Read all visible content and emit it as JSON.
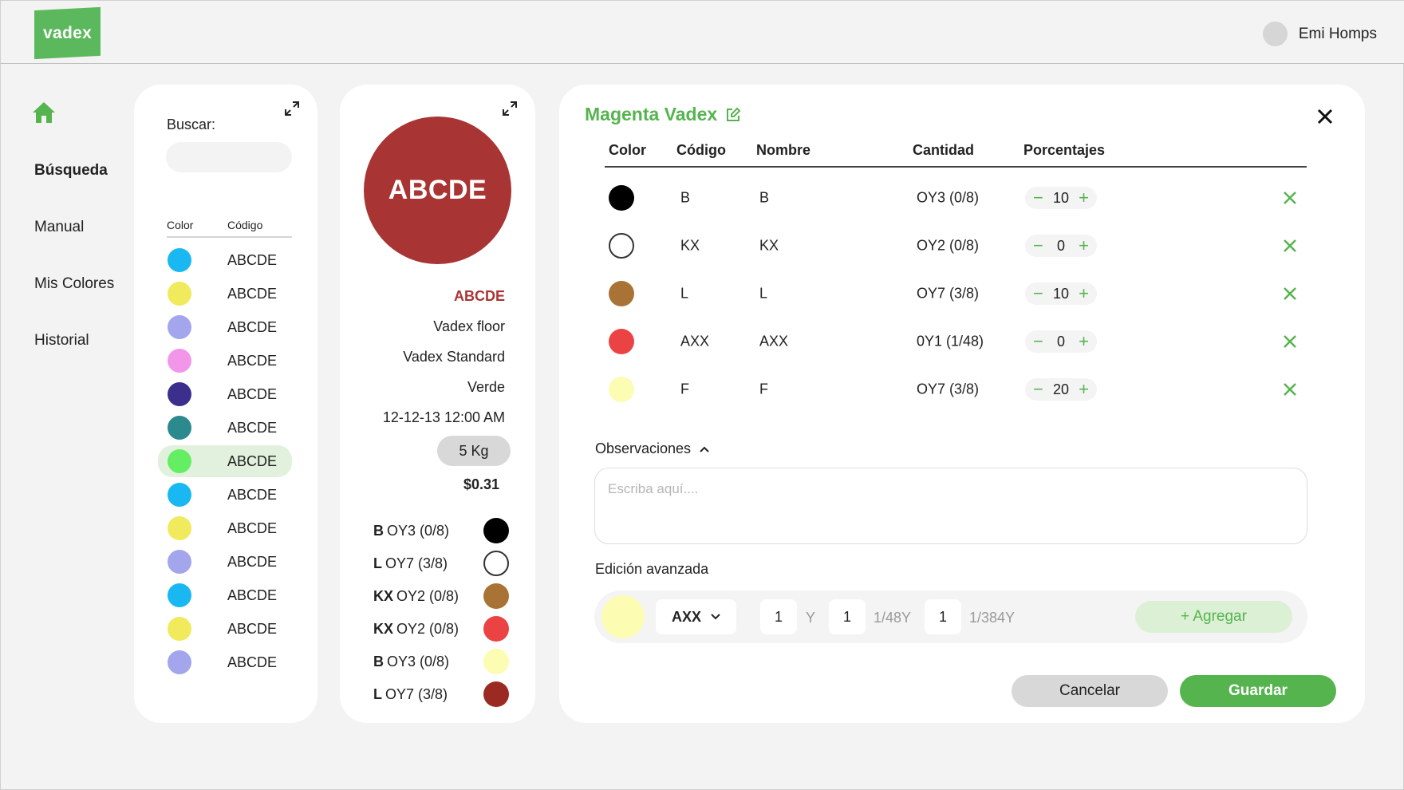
{
  "header": {
    "logo_text": "vadex",
    "user_name": "Emi Homps"
  },
  "nav": {
    "items": [
      {
        "label": "Búsqueda",
        "active": true
      },
      {
        "label": "Manual",
        "active": false
      },
      {
        "label": "Mis Colores",
        "active": false
      },
      {
        "label": "Historial",
        "active": false
      }
    ]
  },
  "search_panel": {
    "label": "Buscar:",
    "input_value": "",
    "col_color": "Color",
    "col_code": "Código",
    "items": [
      {
        "color": "#1ab8f2",
        "code": "ABCDE"
      },
      {
        "color": "#f0ea5c",
        "code": "ABCDE"
      },
      {
        "color": "#a3a6ec",
        "code": "ABCDE"
      },
      {
        "color": "#f296ea",
        "code": "ABCDE"
      },
      {
        "color": "#3b2e8c",
        "code": "ABCDE"
      },
      {
        "color": "#2b8a8e",
        "code": "ABCDE"
      },
      {
        "color": "#63ee63",
        "code": "ABCDE",
        "selected": true
      },
      {
        "color": "#1ab8f2",
        "code": "ABCDE"
      },
      {
        "color": "#f0ea5c",
        "code": "ABCDE"
      },
      {
        "color": "#a3a6ec",
        "code": "ABCDE"
      },
      {
        "color": "#1ab8f2",
        "code": "ABCDE"
      },
      {
        "color": "#f0ea5c",
        "code": "ABCDE"
      },
      {
        "color": "#a3a6ec",
        "code": "ABCDE"
      }
    ]
  },
  "detail_panel": {
    "swatch_label": "ABCDE",
    "swatch_color": "#a93434",
    "code": "ABCDE",
    "line1": "Vadex floor",
    "line2": "Vadex Standard",
    "line3": "Verde",
    "datetime": "12-12-13 12:00 AM",
    "weight": "5 Kg",
    "price": "$0.31",
    "components": [
      {
        "code": "B",
        "qty": "OY3 (0/8)",
        "color": "#000000"
      },
      {
        "code": "L",
        "qty": "OY7 (3/8)",
        "color": "#ffffff"
      },
      {
        "code": "KX",
        "qty": "OY2 (0/8)",
        "color": "#a87334"
      },
      {
        "code": "KX",
        "qty": "OY2 (0/8)",
        "color": "#eb4343"
      },
      {
        "code": "B",
        "qty": "OY3 (0/8)",
        "color": "#fcfcb3"
      },
      {
        "code": "L",
        "qty": "OY7 (3/8)",
        "color": "#9a2a22"
      }
    ]
  },
  "main_panel": {
    "title": "Magenta Vadex",
    "columns": [
      "Color",
      "Código",
      "Nombre",
      "Cantidad",
      "Porcentajes"
    ],
    "rows": [
      {
        "color": "#000000",
        "code": "B",
        "name": "B",
        "qty": "OY3 (0/8)",
        "pct": "10"
      },
      {
        "color": "#ffffff",
        "code": "KX",
        "name": "KX",
        "qty": "OY2 (0/8)",
        "pct": "0"
      },
      {
        "color": "#a87334",
        "code": "L",
        "name": "L",
        "qty": "OY7 (3/8)",
        "pct": "10"
      },
      {
        "color": "#eb4343",
        "code": "AXX",
        "name": "AXX",
        "qty": "0Y1 (1/48)",
        "pct": "0"
      },
      {
        "color": "#fcfcb3",
        "code": "F",
        "name": "F",
        "qty": "OY7 (3/8)",
        "pct": "20"
      }
    ],
    "observations_label": "Observaciones",
    "observations_placeholder": "Escriba aquí....",
    "advanced_label": "Edición avanzada",
    "advanced": {
      "color": "#fcfcb3",
      "selected_code": "AXX",
      "v1": "1",
      "u1": "Y",
      "v2": "1",
      "u2": "1/48Y",
      "v3": "1",
      "u3": "1/384Y",
      "add_label": "+ Agregar"
    },
    "cancel_label": "Cancelar",
    "save_label": "Guardar"
  },
  "colors": {
    "brand_green": "#56b44f",
    "logo_green": "#5cb85c",
    "accent_red": "#a93434"
  }
}
